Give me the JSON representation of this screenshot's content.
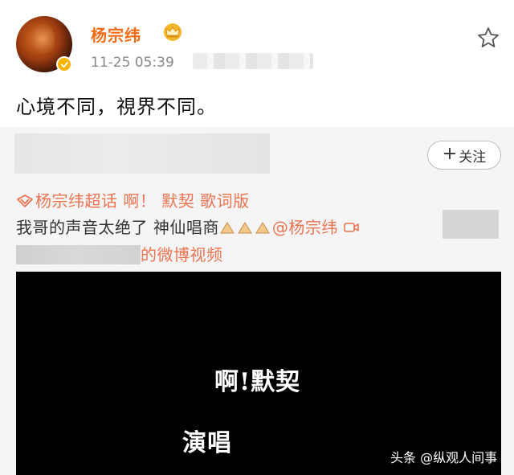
{
  "post": {
    "username": "杨宗纬",
    "timestamp": "11-25 05:39",
    "text": "心境不同，視界不同。"
  },
  "repost": {
    "follow_label": "关注",
    "line1": "杨宗纬超话 啊！ 默契 歌词版",
    "line2_text": "我哥的声音太绝了 神仙唱商",
    "line2_mention": "@杨宗纬",
    "line3_link": "的微博视频"
  },
  "video": {
    "title": "啊!默契",
    "subtitle": "演唱"
  },
  "watermark": "头条 @纵观人间事",
  "colors": {
    "username": "#f26a11",
    "link": "#eb7350",
    "verified": "#f8b400"
  },
  "icons": [
    "verified-icon",
    "crown-icon",
    "star-icon",
    "topic-icon",
    "praying-hands-icon",
    "video-camera-icon"
  ]
}
